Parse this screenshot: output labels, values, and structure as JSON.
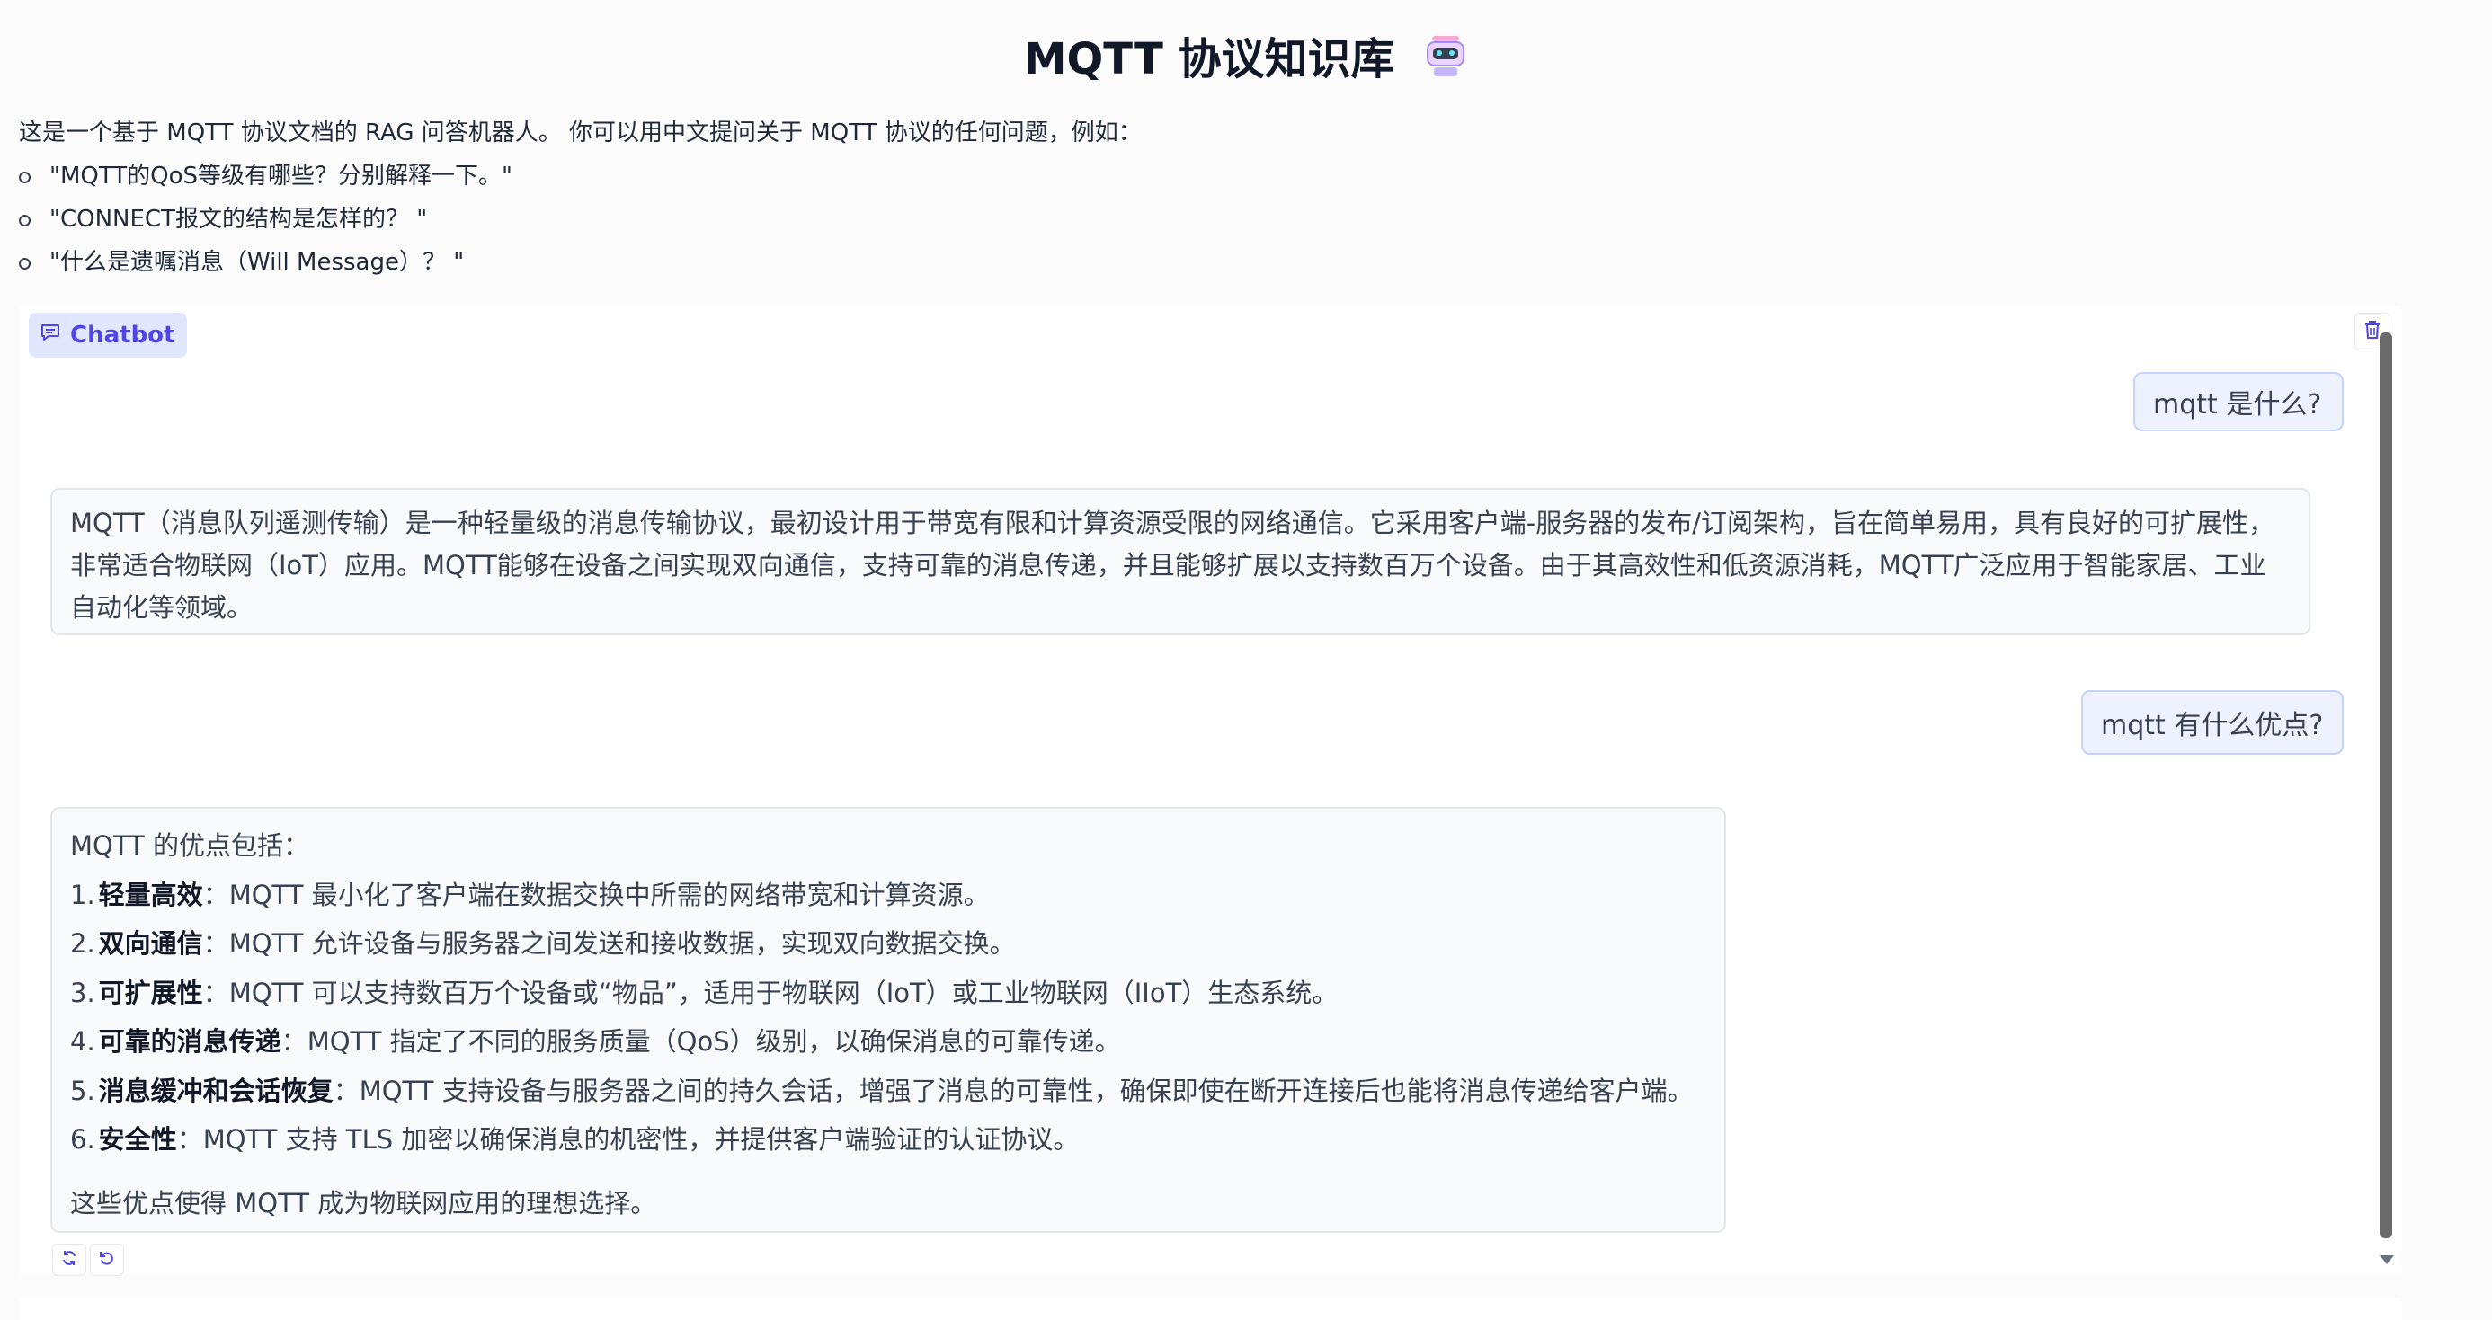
{
  "header": {
    "title": "MQTT 协议知识库"
  },
  "description": {
    "intro": "这是一个基于 MQTT 协议文档的 RAG 问答机器人。 你可以用中文提问关于 MQTT 协议的任何问题，例如：",
    "examples": [
      "\"MQTT的QoS等级有哪些？分别解释一下。\"",
      "\"CONNECT报文的结构是怎样的？ \"",
      "\"什么是遗嘱消息（Will Message）？ \""
    ]
  },
  "chatbot": {
    "label": "Chatbot",
    "messages": [
      {
        "role": "user",
        "text": "mqtt 是什么?"
      },
      {
        "role": "bot",
        "text": "MQTT（消息队列遥测传输）是一种轻量级的消息传输协议，最初设计用于带宽有限和计算资源受限的网络通信。它采用客户端-服务器的发布/订阅架构，旨在简单易用，具有良好的可扩展性，非常适合物联网（IoT）应用。MQTT能够在设备之间实现双向通信，支持可靠的消息传递，并且能够扩展以支持数百万个设备。由于其高效性和低资源消耗，MQTT广泛应用于智能家居、工业自动化等领域。"
      },
      {
        "role": "user",
        "text": "mqtt 有什么优点?"
      },
      {
        "role": "bot",
        "intro": "MQTT 的优点包括：",
        "items": [
          {
            "num": "1.",
            "title": "轻量高效",
            "text": "：MQTT 最小化了客户端在数据交换中所需的网络带宽和计算资源。"
          },
          {
            "num": "2.",
            "title": "双向通信",
            "text": "：MQTT 允许设备与服务器之间发送和接收数据，实现双向数据交换。"
          },
          {
            "num": "3.",
            "title": "可扩展性",
            "text": "：MQTT 可以支持数百万个设备或“物品”，适用于物联网（IoT）或工业物联网（IIoT）生态系统。"
          },
          {
            "num": "4.",
            "title": "可靠的消息传递",
            "text": "：MQTT 指定了不同的服务质量（QoS）级别，以确保消息的可靠传递。"
          },
          {
            "num": "5.",
            "title": "消息缓冲和会话恢复",
            "text": "：MQTT 支持设备与服务器之间的持久会话，增强了消息的可靠性，确保即使在断开连接后也能将消息传递给客户端。"
          },
          {
            "num": "6.",
            "title": "安全性",
            "text": "：MQTT 支持 TLS 加密以确保消息的机密性，并提供客户端验证的认证协议。"
          }
        ],
        "outro": "这些优点使得 MQTT 成为物联网应用的理想选择。"
      }
    ]
  },
  "icons": [
    "robot-icon",
    "chat-icon",
    "trash-icon",
    "retry-icon",
    "undo-icon",
    "chevron-down-icon"
  ],
  "colors": {
    "accent": "#4f46e5",
    "label_bg": "#e0e7ff",
    "user_bubble": "#eef2ff",
    "user_border": "#c7d2fe"
  }
}
